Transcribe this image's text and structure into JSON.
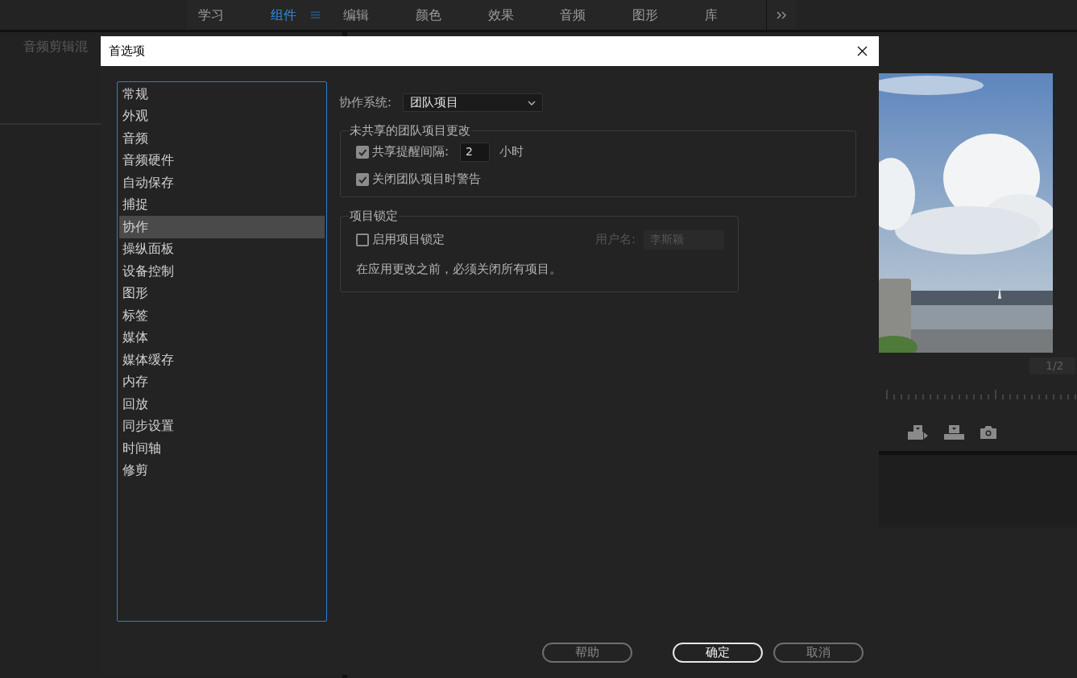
{
  "workspace_tabs": [
    {
      "label": "学习",
      "selected": false
    },
    {
      "label": "组件",
      "selected": true
    },
    {
      "label": "编辑",
      "selected": false
    },
    {
      "label": "颜色",
      "selected": false
    },
    {
      "label": "效果",
      "selected": false
    },
    {
      "label": "音频",
      "selected": false
    },
    {
      "label": "图形",
      "selected": false
    },
    {
      "label": "库",
      "selected": false
    }
  ],
  "left_panel": {
    "title": "音频剪辑混"
  },
  "program_monitor": {
    "page_indicator": "1/2"
  },
  "dialog": {
    "title": "首选项",
    "categories": [
      {
        "label": "常规",
        "selected": false
      },
      {
        "label": "外观",
        "selected": false
      },
      {
        "label": "音频",
        "selected": false
      },
      {
        "label": "音频硬件",
        "selected": false
      },
      {
        "label": "自动保存",
        "selected": false
      },
      {
        "label": "捕捉",
        "selected": false
      },
      {
        "label": "协作",
        "selected": true
      },
      {
        "label": "操纵面板",
        "selected": false
      },
      {
        "label": "设备控制",
        "selected": false
      },
      {
        "label": "图形",
        "selected": false
      },
      {
        "label": "标签",
        "selected": false
      },
      {
        "label": "媒体",
        "selected": false
      },
      {
        "label": "媒体缓存",
        "selected": false
      },
      {
        "label": "内存",
        "selected": false
      },
      {
        "label": "回放",
        "selected": false
      },
      {
        "label": "同步设置",
        "selected": false
      },
      {
        "label": "时间轴",
        "selected": false
      },
      {
        "label": "修剪",
        "selected": false
      }
    ],
    "collab_system": {
      "label": "协作系统:",
      "value": "团队项目"
    },
    "unshared_changes": {
      "title": "未共享的团队项目更改",
      "options": [
        {
          "kind": "interval",
          "label": "共享提醒间隔:",
          "checked": true,
          "value": "2",
          "unit": "小时"
        },
        {
          "kind": "plain",
          "label": "关闭团队项目时警告",
          "checked": true
        }
      ]
    },
    "project_lock": {
      "title": "项目锁定",
      "enable": {
        "label": "启用项目锁定",
        "checked": false
      },
      "username": {
        "label": "用户名:",
        "value": "李斯颖",
        "disabled": true
      },
      "note": "在应用更改之前，必须关闭所有项目。"
    },
    "buttons": [
      {
        "label": "帮助",
        "default": false
      },
      {
        "label": "确定",
        "default": true
      },
      {
        "label": "取消",
        "default": false
      }
    ]
  }
}
